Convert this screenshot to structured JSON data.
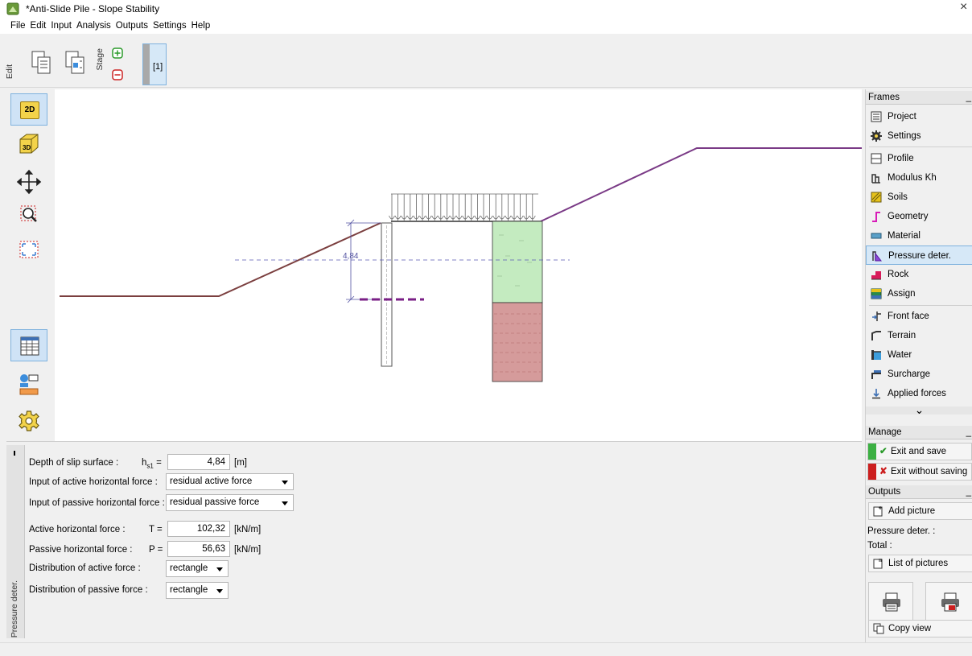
{
  "window": {
    "title": "*Anti-Slide Pile - Slope Stability",
    "close_glyph": "×"
  },
  "menu": [
    "File",
    "Edit",
    "Input",
    "Analysis",
    "Outputs",
    "Settings",
    "Help"
  ],
  "toolbar": {
    "edit_label": "Edit",
    "stage_label": "Stage",
    "stage_button": "[1]"
  },
  "left_tools": {
    "view_2d": "2D",
    "view_3d": "3D"
  },
  "canvas": {
    "dimension_label": "4,84"
  },
  "frames": {
    "header": "Frames",
    "items": [
      {
        "label": "Project",
        "icon": "project-icon"
      },
      {
        "label": "Settings",
        "icon": "gear-icon"
      },
      {
        "label": "Profile",
        "icon": "profile-icon"
      },
      {
        "label": "Modulus Kh",
        "icon": "modulus-icon"
      },
      {
        "label": "Soils",
        "icon": "soils-icon"
      },
      {
        "label": "Geometry",
        "icon": "geometry-icon"
      },
      {
        "label": "Material",
        "icon": "material-icon"
      },
      {
        "label": "Pressure deter.",
        "icon": "pressure-icon"
      },
      {
        "label": "Rock",
        "icon": "rock-icon"
      },
      {
        "label": "Assign",
        "icon": "assign-icon"
      },
      {
        "label": "Front face",
        "icon": "front-face-icon"
      },
      {
        "label": "Terrain",
        "icon": "terrain-icon"
      },
      {
        "label": "Water",
        "icon": "water-icon"
      },
      {
        "label": "Surcharge",
        "icon": "surcharge-icon"
      },
      {
        "label": "Applied forces",
        "icon": "applied-forces-icon"
      }
    ],
    "selected": "Pressure deter.",
    "scroll_glyph": "⌄"
  },
  "manage": {
    "header": "Manage",
    "exit_save": "Exit and save",
    "exit_nosave": "Exit without saving"
  },
  "outputs": {
    "header": "Outputs",
    "add_picture": "Add picture",
    "pressure_deter_label": "Pressure deter. :",
    "total_label": "Total :",
    "list_pictures": "List of pictures",
    "copy_view": "Copy view"
  },
  "form": {
    "tab_label": "Pressure deter.",
    "depth_label": "Depth of slip surface :",
    "depth_symbol": "h",
    "depth_sub": "s1",
    "depth_eq": "=",
    "depth_value": "4,84",
    "depth_unit": "[m]",
    "active_input_label": "Input of active horizontal force :",
    "active_input_value": "residual active force",
    "passive_input_label": "Input of passive horizontal force :",
    "passive_input_value": "residual passive force",
    "active_force_label": "Active horizontal force :",
    "active_force_symbol": "T =",
    "active_force_value": "102,32",
    "active_force_unit": "[kN/m]",
    "passive_force_label": "Passive horizontal force :",
    "passive_force_symbol": "P =",
    "passive_force_value": "56,63",
    "passive_force_unit": "[kN/m]",
    "dist_active_label": "Distribution of active force :",
    "dist_active_value": "rectangle",
    "dist_passive_label": "Distribution of passive force :",
    "dist_passive_value": "rectangle"
  },
  "colors": {
    "terrain_left": "#7b3f3f",
    "terrain_right": "#7a3a86",
    "soil_green": "#c4ebc0",
    "soil_red": "#d59b9b",
    "selection_blue": "#d6e8f7",
    "exit_green": "#3cb043",
    "exit_red": "#cc1f1f"
  }
}
